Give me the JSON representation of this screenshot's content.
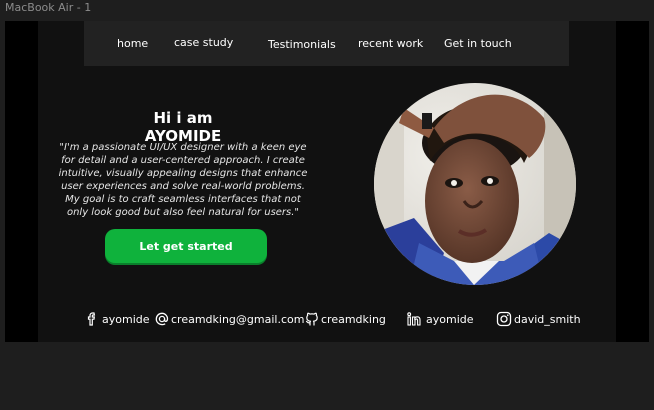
{
  "canvas": {
    "frame_label": "MacBook Air - 1"
  },
  "nav": {
    "items": [
      {
        "label": "home"
      },
      {
        "label": "case study"
      },
      {
        "label": "Testimonials"
      },
      {
        "label": "recent work"
      },
      {
        "label": "Get in touch"
      }
    ]
  },
  "hero": {
    "title": "Hi i am AYOMIDE",
    "description": "\"I'm a passionate UI/UX designer with a keen eye for detail and a user-centered approach. I create intuitive, visually appealing designs that enhance user experiences and solve real-world problems. My goal is to craft seamless interfaces that not only look good but also feel natural for users.\"",
    "cta_label": "Let get started"
  },
  "socials": [
    {
      "icon": "facebook-icon",
      "label": "ayomide"
    },
    {
      "icon": "at-sign-icon",
      "label": "creamdking@gmail.com"
    },
    {
      "icon": "github-icon",
      "label": "creamdking"
    },
    {
      "icon": "linkedin-icon",
      "label": "ayomide"
    },
    {
      "icon": "instagram-icon",
      "label": "david_smith"
    }
  ],
  "colors": {
    "background": "#111111",
    "nav": "#222222",
    "accent": "#0fb23c"
  }
}
